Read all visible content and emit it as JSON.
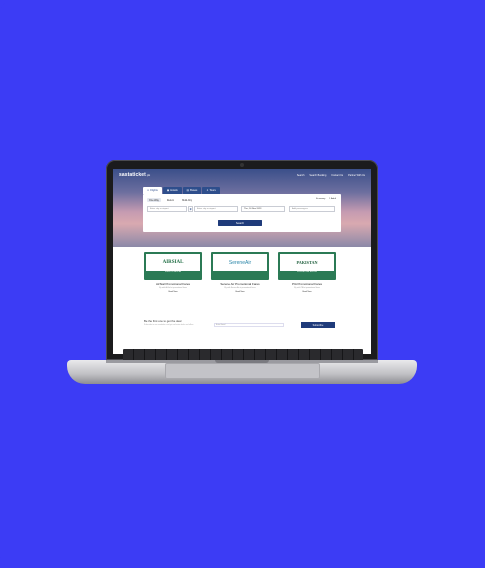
{
  "site": {
    "logo": "sastaticket",
    "logo_suffix": ".pk",
    "nav": [
      "Search",
      "Search Booking",
      "Contact Us",
      "Partner With Us"
    ]
  },
  "search": {
    "tabs": [
      {
        "label": "Flights",
        "icon": "plane-icon"
      },
      {
        "label": "Hotels",
        "icon": "hotel-icon"
      },
      {
        "label": "Buses",
        "icon": "bus-icon"
      },
      {
        "label": "Tours",
        "icon": "tour-icon"
      }
    ],
    "trip_types": [
      "One Way",
      "Return",
      "Multi-City"
    ],
    "class_options": [
      "Economy",
      "1 Adult"
    ],
    "from_placeholder": "Enter city or airport",
    "to_placeholder": "Enter city or airport",
    "date_value": "Thu, 16 Nov 2023",
    "passengers_placeholder": "Add passengers",
    "search_button": "Search"
  },
  "promos": [
    {
      "brand": "AIRSIAL",
      "tagline": "WINGS OF PAKISTAN",
      "title": "AirSial Promotional Fares",
      "desc": "Fly with AirSial at promotional fares",
      "button": "Book Now"
    },
    {
      "brand": "SereneAir",
      "tagline": "",
      "title": "Serene Air Promotional Fares",
      "desc": "Fly with Serene Air at promotional fares",
      "button": "Book Now"
    },
    {
      "brand": "PAKISTAN",
      "tagline": "INTERNATIONAL AIRLINES",
      "title": "PIA Promotional Fares",
      "desc": "Fly with PIA at promotional fares",
      "button": "Book Now"
    }
  ],
  "newsletter": {
    "title": "Be the first one to get the deal",
    "desc": "Subscribe to our newsletter and get exclusive deals and offers",
    "placeholder": "Enter Email",
    "button": "Subscribe"
  },
  "colors": {
    "background": "#3c3cf5",
    "brand_navy": "#1f3b7a",
    "promo_green": "#2b7a55"
  }
}
